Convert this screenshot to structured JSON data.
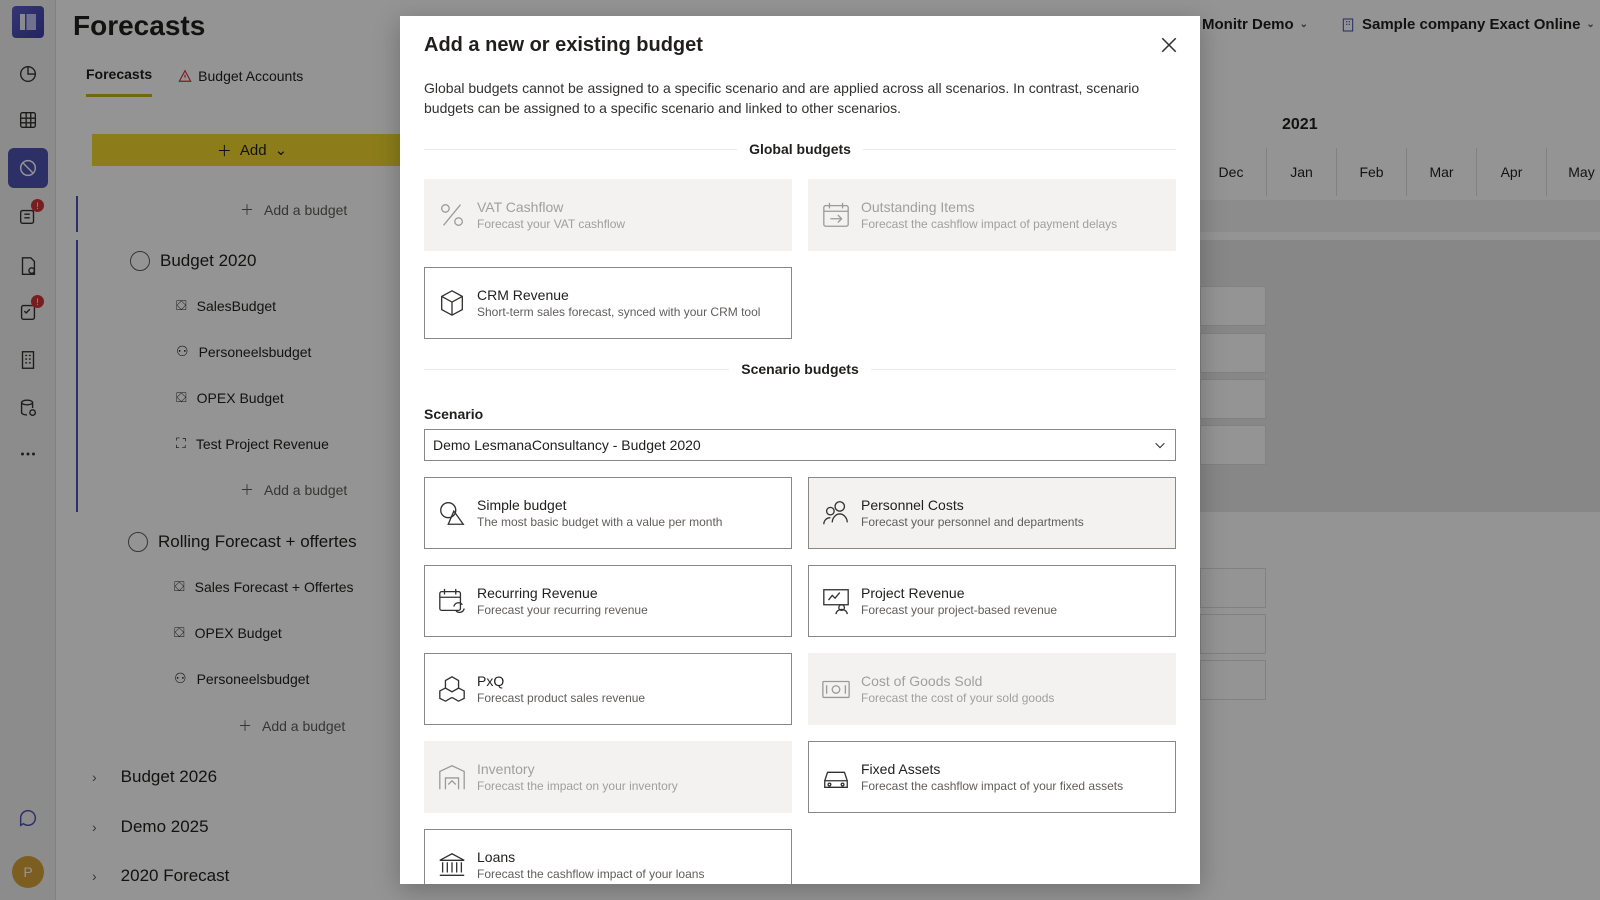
{
  "header": {
    "title": "Forecasts",
    "workspace": "Monitr Demo",
    "company": "Sample company Exact Online"
  },
  "tabs": [
    {
      "label": "Forecasts"
    },
    {
      "label": "Budget Accounts"
    }
  ],
  "toolbar": {
    "add_label": "Add"
  },
  "tree": {
    "add_budget_label": "Add a budget",
    "groups": [
      {
        "label": "Budget 2020",
        "items": [
          "SalesBudget",
          "Personeelsbudget",
          "OPEX Budget",
          "Test Project Revenue"
        ]
      },
      {
        "label": "Rolling Forecast + offertes",
        "items": [
          "Sales Forecast + Offertes",
          "OPEX Budget",
          "Personeelsbudget"
        ]
      }
    ],
    "collapsed": [
      "Budget 2026",
      "Demo 2025",
      "2020 Forecast"
    ]
  },
  "timeline": {
    "year": "2021",
    "months": [
      "Dec",
      "Jan",
      "Feb",
      "Mar",
      "Apr",
      "May"
    ]
  },
  "rail": {
    "avatar_initial": "P"
  },
  "dialog": {
    "title": "Add a new or existing budget",
    "description": "Global budgets cannot be assigned to a specific scenario and are applied across all scenarios. In contrast, scenario budgets can be assigned to a specific scenario and linked to other scenarios.",
    "global_header": "Global budgets",
    "scenario_header": "Scenario budgets",
    "scenario_label": "Scenario",
    "scenario_value": "Demo LesmanaConsultancy - Budget 2020",
    "global_cards": [
      {
        "title": "VAT Cashflow",
        "subtitle": "Forecast your VAT cashflow",
        "icon": "percent-icon",
        "disabled": true
      },
      {
        "title": "Outstanding Items",
        "subtitle": "Forecast the cashflow impact of payment delays",
        "icon": "calendar-arrow-icon",
        "disabled": true
      },
      {
        "title": "CRM Revenue",
        "subtitle": "Short-term sales forecast, synced with your CRM tool",
        "icon": "cube-icon",
        "disabled": false
      }
    ],
    "scenario_cards": [
      {
        "title": "Simple budget",
        "subtitle": "The most basic budget with a value per month",
        "icon": "shapes-icon",
        "disabled": false
      },
      {
        "title": "Personnel Costs",
        "subtitle": "Forecast your personnel and departments",
        "icon": "people-icon",
        "disabled": false,
        "hovered": true
      },
      {
        "title": "Recurring Revenue",
        "subtitle": "Forecast your recurring revenue",
        "icon": "calendar-sync-icon",
        "disabled": false
      },
      {
        "title": "Project Revenue",
        "subtitle": "Forecast your project-based revenue",
        "icon": "presenter-icon",
        "disabled": false
      },
      {
        "title": "PxQ",
        "subtitle": "Forecast product sales revenue",
        "icon": "boxes-icon",
        "disabled": false
      },
      {
        "title": "Cost of Goods Sold",
        "subtitle": "Forecast the cost of your sold goods",
        "icon": "money-icon",
        "disabled": true
      },
      {
        "title": "Inventory",
        "subtitle": "Forecast the impact on your inventory",
        "icon": "warehouse-icon",
        "disabled": true
      },
      {
        "title": "Fixed Assets",
        "subtitle": "Forecast the cashflow impact of your fixed assets",
        "icon": "car-icon",
        "disabled": false
      },
      {
        "title": "Loans",
        "subtitle": "Forecast the cashflow impact of your loans",
        "icon": "bank-icon",
        "disabled": false
      }
    ]
  },
  "colors": {
    "accent": "#4f52b2",
    "add_button": "#f2d82d",
    "tab_underline": "#c9b21b"
  }
}
